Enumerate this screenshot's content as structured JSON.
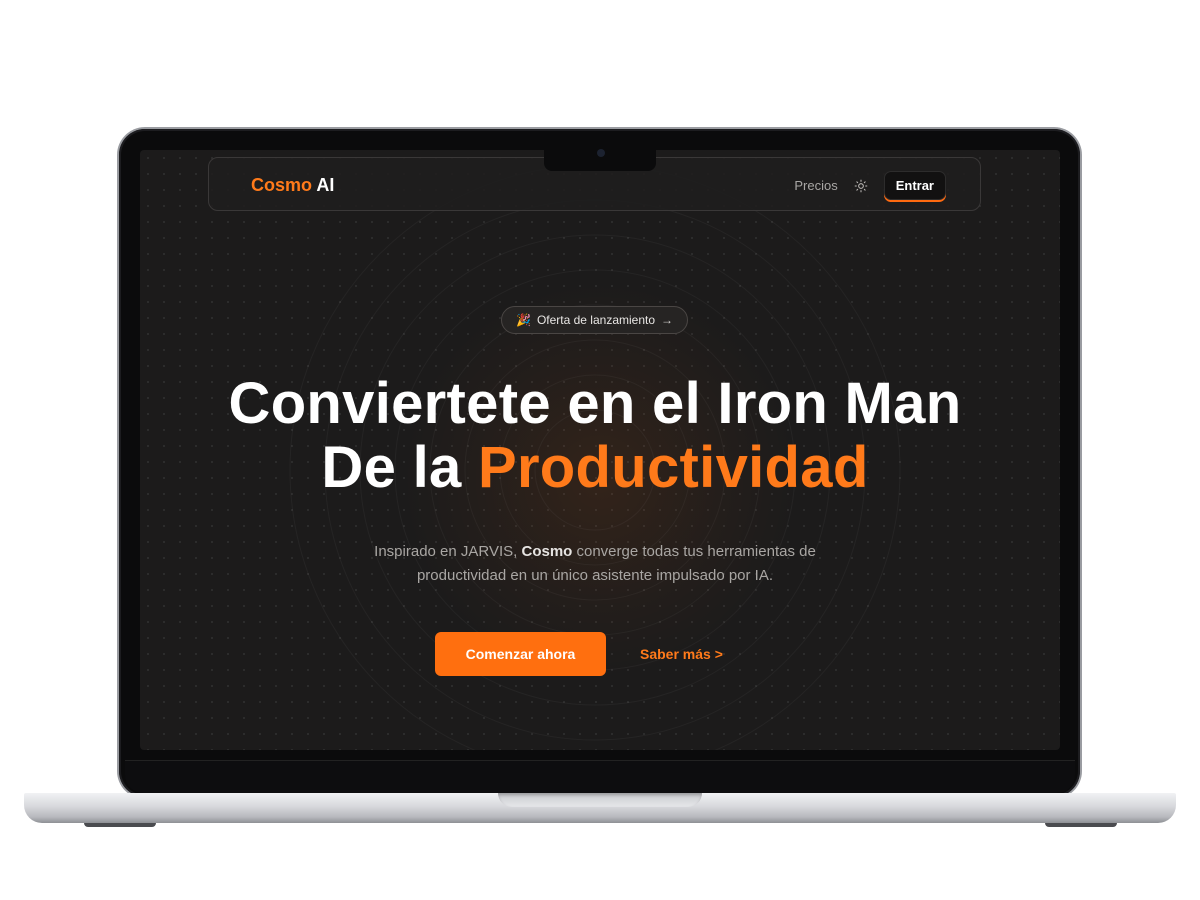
{
  "brand": {
    "name_part1": "Cosmo",
    "name_part2": "AI",
    "accent_color": "#ff7a1a"
  },
  "nav": {
    "pricing_label": "Precios",
    "theme_icon": "sun-icon",
    "login_label": "Entrar"
  },
  "badge": {
    "icon": "party-popper-icon",
    "label": "Oferta de lanzamiento",
    "arrow": "→"
  },
  "hero": {
    "line1": "Conviertete en el Iron Man",
    "line2_prefix": "De la ",
    "line2_accent": "Productividad",
    "subtitle_prefix": "Inspirado en JARVIS, ",
    "subtitle_bold": "Cosmo",
    "subtitle_suffix": " converge todas tus herramientas de productividad en un único asistente impulsado por IA."
  },
  "actions": {
    "primary_label": "Comenzar ahora",
    "secondary_label": "Saber más >"
  }
}
